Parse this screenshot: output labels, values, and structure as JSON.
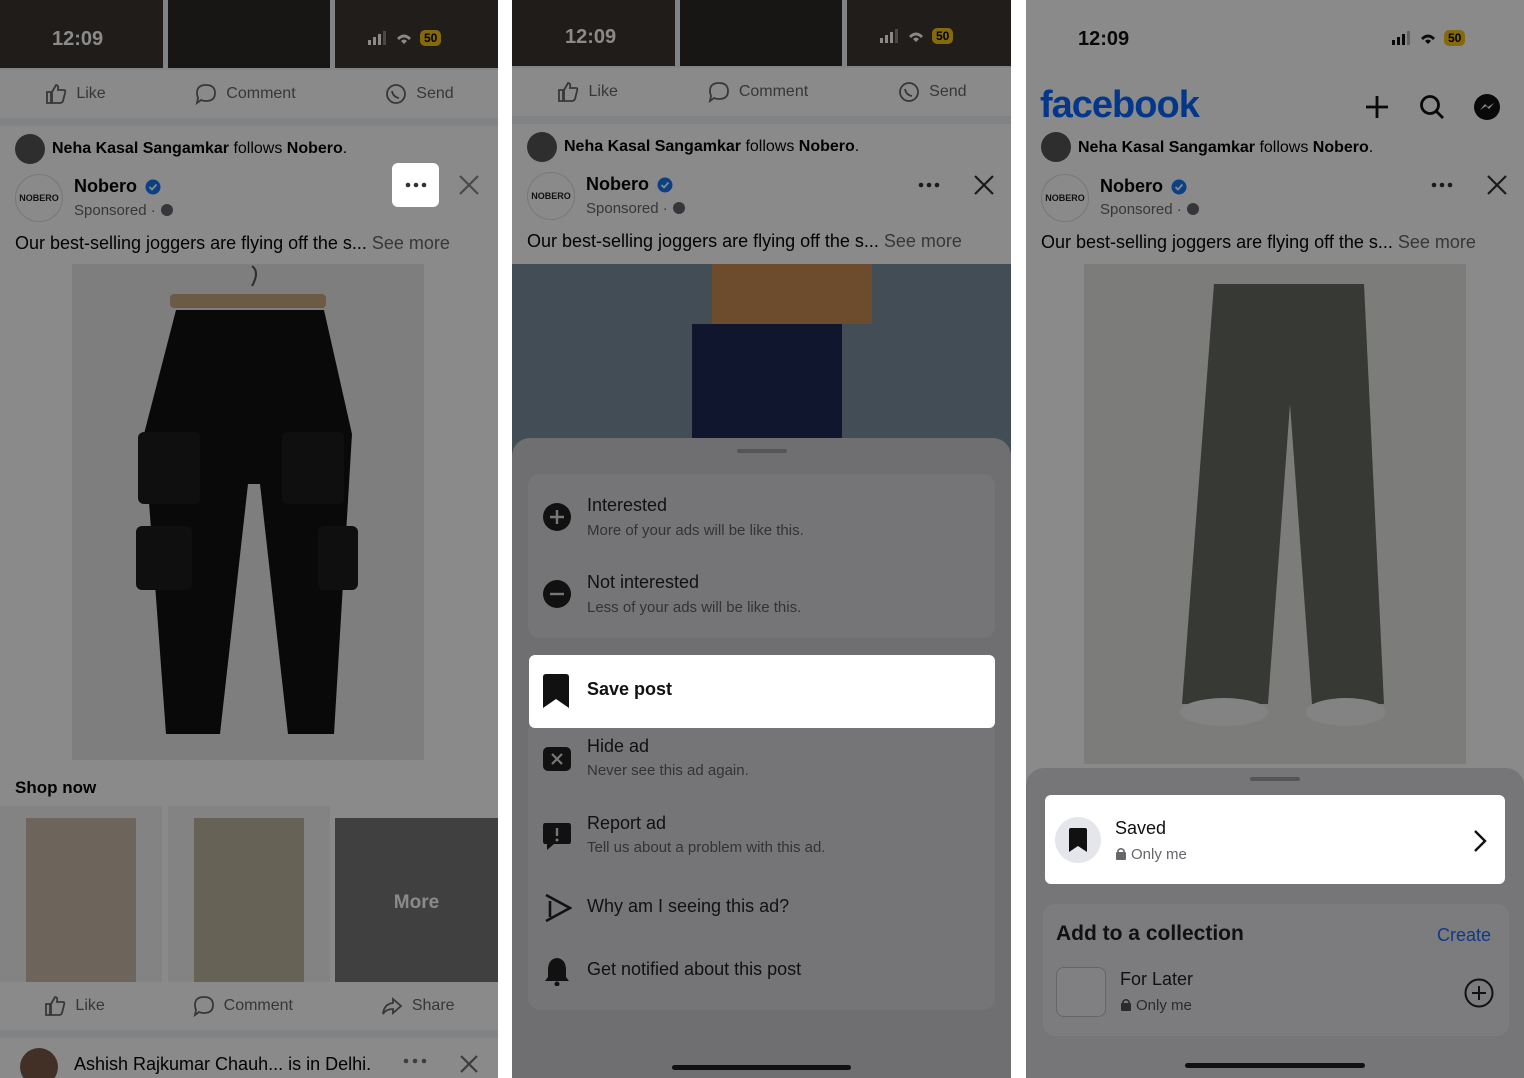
{
  "status": {
    "time": "12:09",
    "battery": "50"
  },
  "post_actions": {
    "like": "Like",
    "comment": "Comment",
    "send": "Send",
    "share": "Share"
  },
  "post": {
    "follower": "Neha Kasal Sangamkar",
    "follows_text": "follows",
    "followed_page": "Nobero",
    "page_name": "Nobero",
    "logo_text": "NOBERO",
    "sponsored": "Sponsored · ",
    "caption": "Our best-selling joggers are flying off the s...",
    "see_more": "See more",
    "shop_now": "Shop now",
    "more_label": "More"
  },
  "next_post": {
    "author_visible": "Ashish Rajkumar Chauh... is in Delhi."
  },
  "menu": {
    "interested": {
      "title": "Interested",
      "subtitle": "More of your ads will be like this."
    },
    "not_interested": {
      "title": "Not interested",
      "subtitle": "Less of your ads will be like this."
    },
    "save_post": "Save post",
    "hide_ad": {
      "title": "Hide ad",
      "subtitle": "Never see this ad again."
    },
    "report_ad": {
      "title": "Report ad",
      "subtitle": "Tell us about a problem with this ad."
    },
    "why": "Why am I seeing this ad?",
    "notify": "Get notified about this post"
  },
  "facebook": {
    "logo": "facebook"
  },
  "save_sheet": {
    "saved_title": "Saved",
    "saved_privacy": "Only me",
    "collection_heading": "Add to a collection",
    "create": "Create",
    "collection_name": "For Later",
    "collection_privacy": "Only me"
  },
  "colors": {
    "fb_blue": "#0866ff",
    "verified": "#1877f2",
    "battery": "#f5c518"
  }
}
